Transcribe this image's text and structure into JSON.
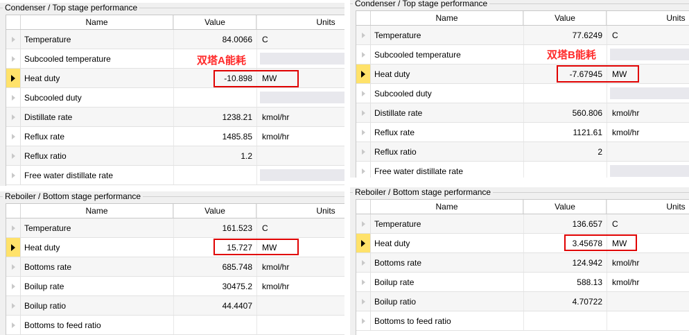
{
  "columns": {
    "name": "Name",
    "value": "Value",
    "units": "Units"
  },
  "left": {
    "condenser": {
      "title": "Condenser / Top stage performance",
      "annotation": "双塔A能耗",
      "rows": [
        {
          "name": "Temperature",
          "value": "84.0066",
          "units": "C"
        },
        {
          "name": "Subcooled temperature",
          "value": "",
          "units": ""
        },
        {
          "name": "Heat duty",
          "value": "-10.898",
          "units": "MW"
        },
        {
          "name": "Subcooled duty",
          "value": "",
          "units": ""
        },
        {
          "name": "Distillate rate",
          "value": "1238.21",
          "units": "kmol/hr"
        },
        {
          "name": "Reflux rate",
          "value": "1485.85",
          "units": "kmol/hr"
        },
        {
          "name": "Reflux ratio",
          "value": "1.2",
          "units": ""
        },
        {
          "name": "Free water distillate rate",
          "value": "",
          "units": ""
        }
      ]
    },
    "reboiler": {
      "title": "Reboiler / Bottom stage performance",
      "rows": [
        {
          "name": "Temperature",
          "value": "161.523",
          "units": "C"
        },
        {
          "name": "Heat duty",
          "value": "15.727",
          "units": "MW"
        },
        {
          "name": "Bottoms rate",
          "value": "685.748",
          "units": "kmol/hr"
        },
        {
          "name": "Boilup rate",
          "value": "30475.2",
          "units": "kmol/hr"
        },
        {
          "name": "Boilup ratio",
          "value": "44.4407",
          "units": ""
        },
        {
          "name": "Bottoms to feed ratio",
          "value": "",
          "units": ""
        }
      ]
    }
  },
  "right": {
    "condenser": {
      "title": "Condenser / Top stage performance",
      "annotation": "双塔B能耗",
      "rows": [
        {
          "name": "Temperature",
          "value": "77.6249",
          "units": "C"
        },
        {
          "name": "Subcooled temperature",
          "value": "",
          "units": ""
        },
        {
          "name": "Heat duty",
          "value": "-7.67945",
          "units": "MW"
        },
        {
          "name": "Subcooled duty",
          "value": "",
          "units": ""
        },
        {
          "name": "Distillate rate",
          "value": "560.806",
          "units": "kmol/hr"
        },
        {
          "name": "Reflux rate",
          "value": "1121.61",
          "units": "kmol/hr"
        },
        {
          "name": "Reflux ratio",
          "value": "2",
          "units": ""
        },
        {
          "name": "Free water distillate rate",
          "value": "",
          "units": ""
        }
      ]
    },
    "reboiler": {
      "title": "Reboiler / Bottom stage performance",
      "rows": [
        {
          "name": "Temperature",
          "value": "136.657",
          "units": "C"
        },
        {
          "name": "Heat duty",
          "value": "3.45678",
          "units": "MW"
        },
        {
          "name": "Bottoms rate",
          "value": "124.942",
          "units": "kmol/hr"
        },
        {
          "name": "Boilup rate",
          "value": "588.13",
          "units": "kmol/hr"
        },
        {
          "name": "Boilup ratio",
          "value": "4.70722",
          "units": ""
        },
        {
          "name": "Bottoms to feed ratio",
          "value": "",
          "units": ""
        }
      ]
    }
  }
}
